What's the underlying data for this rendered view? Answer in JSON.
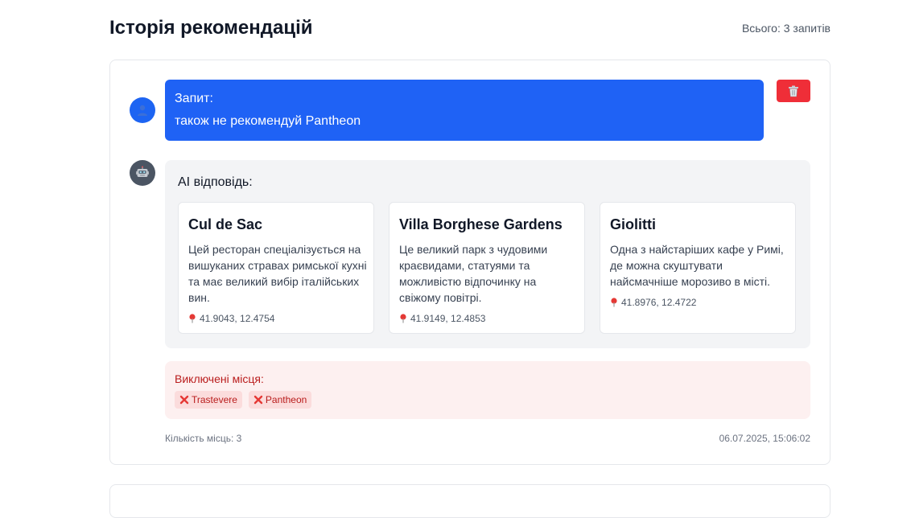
{
  "header": {
    "title": "Історія рекомендацій",
    "total": "Всього: 3 запитів"
  },
  "entry": {
    "query_label": "Запит:",
    "query_text": "також не рекомендуй Pantheon",
    "delete_icon": "trash-icon",
    "ai_label": "AI відповідь:",
    "places": [
      {
        "name": "Cul de Sac",
        "description": "Цей ресторан спеціалізується на вишуканих стравах римської кухні та має великий вибір італійських вин.",
        "coords": "41.9043, 12.4754"
      },
      {
        "name": "Villa Borghese Gardens",
        "description": "Це великий парк з чудовими краєвидами, статуями та можливістю відпочинку на свіжому повітрі.",
        "coords": "41.9149, 12.4853"
      },
      {
        "name": "Giolitti",
        "description": "Одна з найстаріших кафе у Римі, де можна скуштувати найсмачніше морозиво в місті.",
        "coords": "41.8976, 12.4722"
      }
    ],
    "excluded_label": "Виключені місця:",
    "excluded": [
      "Trastevere",
      "Pantheon"
    ],
    "places_count": "Кількість місць: 3",
    "timestamp": "06.07.2025, 15:06:02"
  },
  "colors": {
    "query_bg": "#1f62f5",
    "delete_bg": "#ef2e38",
    "excluded_bg": "#fdf0f0",
    "excluded_text": "#b91c1c"
  }
}
